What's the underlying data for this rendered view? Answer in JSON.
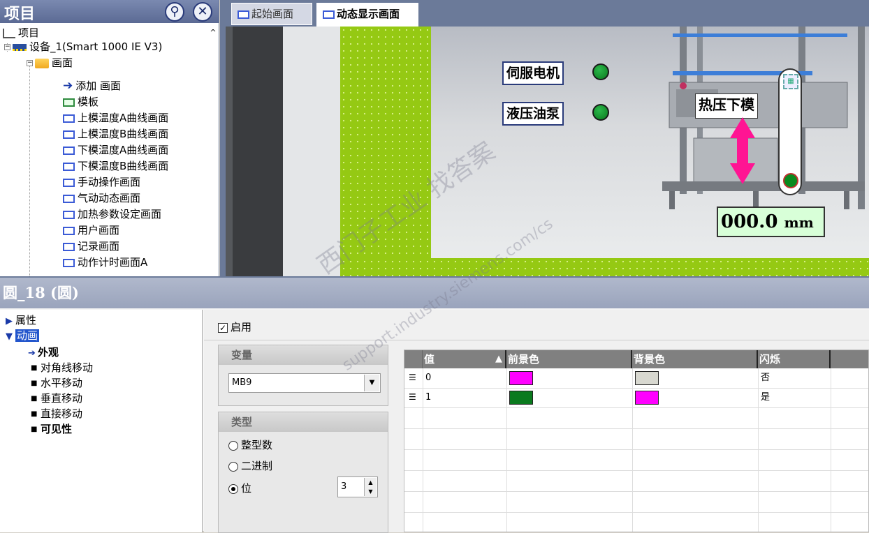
{
  "project": {
    "title": "项目",
    "pin_icon": "pin-icon",
    "close_icon": "close-icon",
    "tree": [
      {
        "label": "项目"
      },
      {
        "label": "设备_1(Smart 1000 IE V3)"
      },
      {
        "label": "画面"
      },
      {
        "label": "添加 画面"
      },
      {
        "label": "模板"
      },
      {
        "label": "上模温度A曲线画面"
      },
      {
        "label": "上模温度B曲线画面"
      },
      {
        "label": "下模温度A曲线画面"
      },
      {
        "label": "下模温度B曲线画面"
      },
      {
        "label": "手动操作画面"
      },
      {
        "label": "气动动态画面"
      },
      {
        "label": "加热参数设定画面"
      },
      {
        "label": "用户画面"
      },
      {
        "label": "记录画面"
      },
      {
        "label": "动作计时画面A"
      }
    ]
  },
  "editor": {
    "tabs": [
      {
        "label": "起始画面"
      },
      {
        "label": "动态显示画面"
      }
    ],
    "canvas": {
      "servo_label": "伺服电机",
      "hydraulic_label": "液压油泵",
      "hot_press_label": "热压下模",
      "value_text": "000.0",
      "value_unit": "mm",
      "watermark_cn": "西门子工业  找答案",
      "watermark_url": "support.industry.siemens.com/cs",
      "lamp_color": "#0a8a1e"
    }
  },
  "properties": {
    "title": "圆_18 (圆)",
    "nav": [
      {
        "label": "属性"
      },
      {
        "label": "动画"
      },
      {
        "label": "外观"
      },
      {
        "label": "对角线移动"
      },
      {
        "label": "水平移动"
      },
      {
        "label": "垂直移动"
      },
      {
        "label": "直接移动"
      },
      {
        "label": "可见性"
      }
    ],
    "enable_label": "启用",
    "variable_group": "变量",
    "variable_value": "MB9",
    "type_group": "类型",
    "type_options": [
      {
        "label": "整型数"
      },
      {
        "label": "二进制"
      },
      {
        "label": "位"
      }
    ],
    "bit_value": "3",
    "table": {
      "headers": [
        "值",
        "前景色",
        "背景色",
        "闪烁"
      ],
      "rows": [
        {
          "value": "0",
          "fg": "#ff00ff",
          "bg": "#d8d8d0",
          "blink": "否"
        },
        {
          "value": "1",
          "fg": "#0a7a1e",
          "bg": "#ff00ff",
          "blink": "是"
        }
      ]
    }
  }
}
